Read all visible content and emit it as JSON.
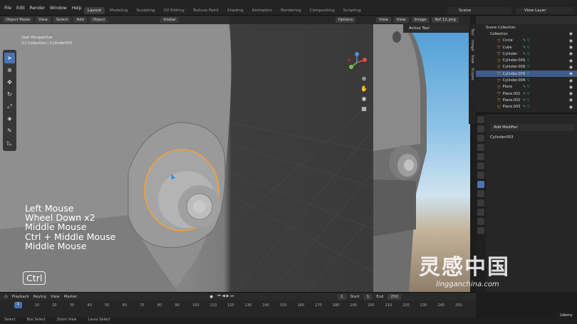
{
  "menu": [
    "File",
    "Edit",
    "Render",
    "Window",
    "Help"
  ],
  "workspaces": [
    "Layout",
    "Modeling",
    "Sculpting",
    "UV Editing",
    "Texture Paint",
    "Shading",
    "Animation",
    "Rendering",
    "Compositing",
    "Scripting"
  ],
  "scene": "Scene",
  "view_layer": "View Layer",
  "viewport": {
    "mode": "Object Mode",
    "menus": [
      "View",
      "Select",
      "Add",
      "Object"
    ],
    "orientation": "Global",
    "options": "Options",
    "info_line1": "User Perspective",
    "info_line2": "(1) Collection | Cylinder003"
  },
  "keys": {
    "line1": "Left Mouse",
    "line2": "Wheel Down x2",
    "line3": "Middle Mouse",
    "line4": "Ctrl + Middle Mouse",
    "line5": "Middle Mouse",
    "ctrl": "Ctrl"
  },
  "preview": {
    "menus": [
      "View",
      "View",
      "Image"
    ],
    "image": "Ref 12.png",
    "active_tool": "Active Tool",
    "side_tabs": [
      "Tool",
      "Image",
      "View",
      "Scopes"
    ]
  },
  "outliner": {
    "root": "Scene Collection",
    "collection": "Collection",
    "items": [
      "Circle",
      "Cube",
      "Cylinder",
      "Cylinder.001",
      "Cylinder.002",
      "Cylinder.003",
      "Cylinder.004",
      "Plane",
      "Plane.001",
      "Plane.002",
      "Plane.003"
    ],
    "selected": "Cylinder.003"
  },
  "properties": {
    "add_modifier": "Add Modifier",
    "object": "Cylinder003"
  },
  "timeline": {
    "menus": [
      "Playback",
      "Keying",
      "View",
      "Marker"
    ],
    "current": "1",
    "start_label": "Start",
    "start": "1",
    "end_label": "End",
    "end": "250",
    "ticks": [
      "0",
      "10",
      "20",
      "30",
      "40",
      "50",
      "60",
      "70",
      "80",
      "90",
      "100",
      "110",
      "120",
      "130",
      "140",
      "150",
      "160",
      "170",
      "180",
      "190",
      "200",
      "210",
      "220",
      "230",
      "240",
      "250"
    ]
  },
  "status": [
    "Select",
    "Box Select",
    "Zoom View",
    "Lasso Select"
  ],
  "watermark": "灵感中国",
  "watermark_url": "lingganchina.com",
  "udemy": "Udemy"
}
